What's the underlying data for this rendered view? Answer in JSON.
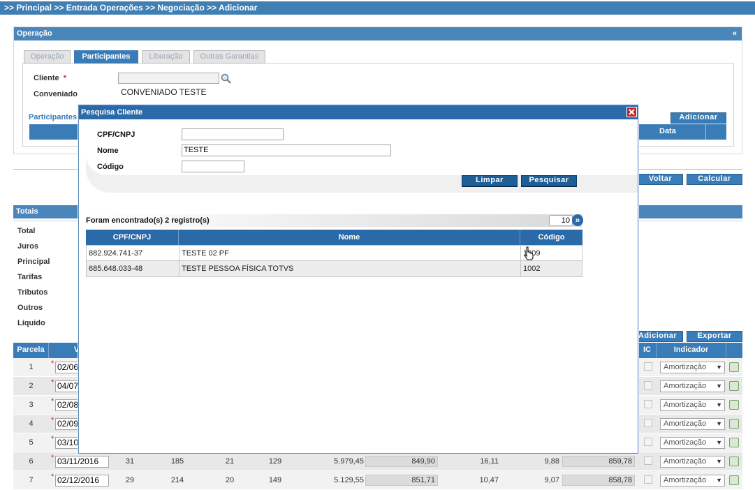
{
  "breadcrumb": {
    "text": ">> Principal >> Entrada Operações  >> Negociação  >> Adicionar"
  },
  "operacao_panel": {
    "title": "Operação",
    "collapse_symbol": "«",
    "tabs": [
      {
        "label": "Operação"
      },
      {
        "label": "Participantes"
      },
      {
        "label": "Liberação"
      },
      {
        "label": "Outras Garantias"
      }
    ],
    "cliente_label": "Cliente",
    "required_mark": "*",
    "conveniado_label": "Conveniado",
    "conveniado_value": "CONVENIADO TESTE",
    "participantes_label": "Participantes",
    "adicionar_label": "Adicionar",
    "data_col": "Data"
  },
  "actions": {
    "voltar": "Voltar",
    "calcular": "Calcular"
  },
  "totais": {
    "title": "Totais",
    "items": [
      "Total",
      "Juros",
      "Principal",
      "Tarifas",
      "Tributos",
      "Outros",
      "Líquido"
    ]
  },
  "parcelas": {
    "adicionar": "Adicionar",
    "exportar": "Exportar",
    "col_parcela": "Parcela",
    "col_v": "V",
    "col_ic": "IC",
    "col_indicador": "Indicador",
    "indicador_value": "Amortização",
    "rows": [
      {
        "n": "1",
        "date": "02/06"
      },
      {
        "n": "2",
        "date": "04/07"
      },
      {
        "n": "3",
        "date": "02/08"
      },
      {
        "n": "4",
        "date": "02/09"
      },
      {
        "n": "5",
        "date": "03/10"
      },
      {
        "n": "6",
        "date": "03/11/2016",
        "c1": "31",
        "c2": "185",
        "c3": "21",
        "c4": "129",
        "c5": "5.979,45",
        "c6": "849,90",
        "c7": "16,11",
        "c8": "9,88",
        "c9": "859,78"
      },
      {
        "n": "7",
        "date": "02/12/2016",
        "c1": "29",
        "c2": "214",
        "c3": "20",
        "c4": "149",
        "c5": "5.129,55",
        "c6": "851,71",
        "c7": "10,47",
        "c8": "9,07",
        "c9": "858,78"
      }
    ]
  },
  "modal": {
    "title": "Pesquisa Cliente",
    "fields": {
      "cpf_label": "CPF/CNPJ",
      "cpf_value": "",
      "nome_label": "Nome",
      "nome_value": "TESTE",
      "codigo_label": "Código",
      "codigo_value": ""
    },
    "limpar": "Limpar",
    "pesquisar": "Pesquisar",
    "result_text": "Foram encontrado(s) 2 registro(s)",
    "page_size": "10",
    "next_symbol": "»",
    "columns": [
      "CPF/CNPJ",
      "Nome",
      "Código"
    ],
    "rows": [
      {
        "cpf": "882.924.741-37",
        "nome": "TESTE 02 PF",
        "codigo": "1009"
      },
      {
        "cpf": "685.648.033-48",
        "nome": "TESTE PESSOA FÍSICA TOTVS",
        "codigo": "1002"
      }
    ]
  },
  "colors": {
    "accent": "#3a7cb7",
    "modal_title": "#2a6aa8",
    "close": "#c0272d"
  }
}
